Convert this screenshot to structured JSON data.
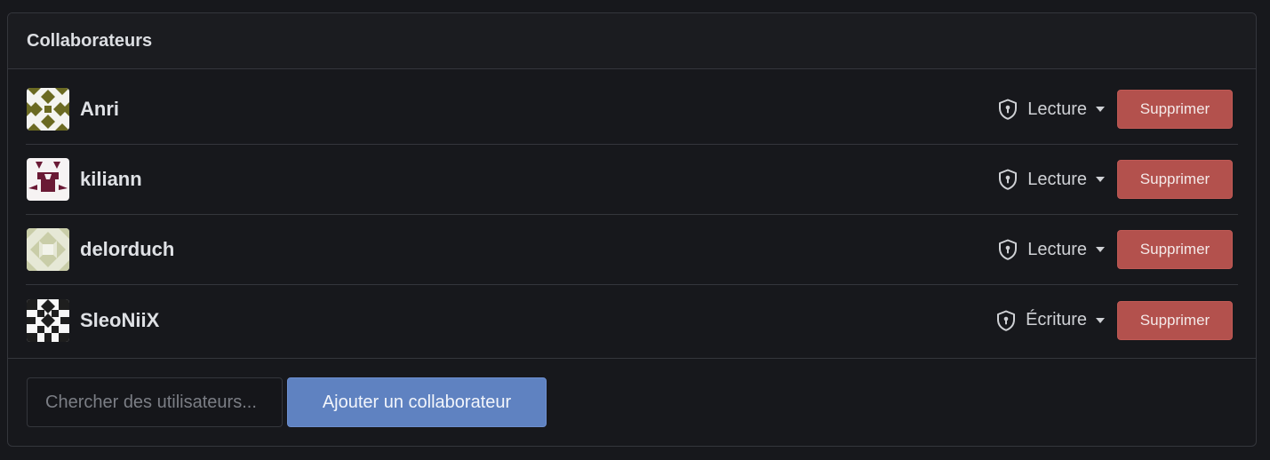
{
  "panel": {
    "title": "Collaborateurs"
  },
  "collaborators": [
    {
      "username": "Anri",
      "permission": "Lecture",
      "delete_label": "Supprimer",
      "avatar_icon": "identicon-anri"
    },
    {
      "username": "kiliann",
      "permission": "Lecture",
      "delete_label": "Supprimer",
      "avatar_icon": "identicon-kiliann"
    },
    {
      "username": "delorduch",
      "permission": "Lecture",
      "delete_label": "Supprimer",
      "avatar_icon": "identicon-delorduch"
    },
    {
      "username": "SleoNiiX",
      "permission": "Écriture",
      "delete_label": "Supprimer",
      "avatar_icon": "identicon-sleoniix"
    }
  ],
  "footer": {
    "search_placeholder": "Chercher des utilisateurs...",
    "add_button_label": "Ajouter un collaborateur"
  },
  "colors": {
    "delete_button": "#b3514d",
    "add_button": "#5f82c1",
    "background": "#17181c",
    "avatar_anri": "#6b6a22",
    "avatar_kiliann": "#6a1a35",
    "avatar_delorduch": "#c9cda8",
    "avatar_sleoniix": "#1e1e1e"
  }
}
